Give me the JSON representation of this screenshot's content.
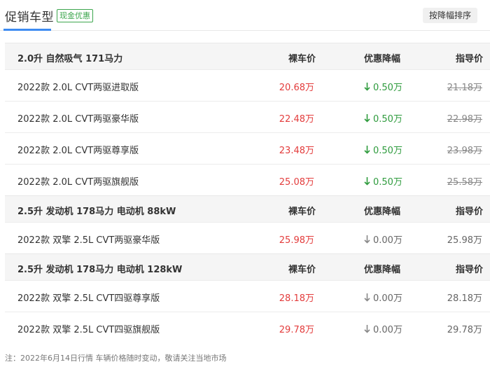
{
  "header": {
    "title": "促销车型",
    "badge": "现金优惠",
    "sort_button": "按降幅排序"
  },
  "groups": [
    {
      "title": "2.0升 自然吸气 171马力",
      "columns": [
        "裸车价",
        "优惠降幅",
        "指导价"
      ],
      "rows": [
        {
          "name": "2022款 2.0L CVT两驱进取版",
          "price": "20.68万",
          "discount": "0.50万",
          "guide": "21.18万",
          "has_discount": true
        },
        {
          "name": "2022款 2.0L CVT两驱豪华版",
          "price": "22.48万",
          "discount": "0.50万",
          "guide": "22.98万",
          "has_discount": true
        },
        {
          "name": "2022款 2.0L CVT两驱尊享版",
          "price": "23.48万",
          "discount": "0.50万",
          "guide": "23.98万",
          "has_discount": true
        },
        {
          "name": "2022款 2.0L CVT两驱旗舰版",
          "price": "25.08万",
          "discount": "0.50万",
          "guide": "25.58万",
          "has_discount": true
        }
      ]
    },
    {
      "title": "2.5升 发动机 178马力 电动机 88kW",
      "columns": [
        "裸车价",
        "优惠降幅",
        "指导价"
      ],
      "rows": [
        {
          "name": "2022款 双擎 2.5L CVT两驱豪华版",
          "price": "25.98万",
          "discount": "0.00万",
          "guide": "25.98万",
          "has_discount": false
        }
      ]
    },
    {
      "title": "2.5升 发动机 178马力 电动机 128kW",
      "columns": [
        "裸车价",
        "优惠降幅",
        "指导价"
      ],
      "rows": [
        {
          "name": "2022款 双擎 2.5L CVT四驱尊享版",
          "price": "28.18万",
          "discount": "0.00万",
          "guide": "28.18万",
          "has_discount": false
        },
        {
          "name": "2022款 双擎 2.5L CVT四驱旗舰版",
          "price": "29.78万",
          "discount": "0.00万",
          "guide": "29.78万",
          "has_discount": false
        }
      ]
    }
  ],
  "note": "注：2022年6月14日行情 车辆价格随时变动，敬请关注当地市场",
  "colors": {
    "price": "#e33c3c",
    "discount_active": "#2e9b3d",
    "discount_none": "#666666",
    "accent": "#3d8bf2"
  },
  "icons": {
    "discount_arrow": "down-arrow-icon"
  }
}
